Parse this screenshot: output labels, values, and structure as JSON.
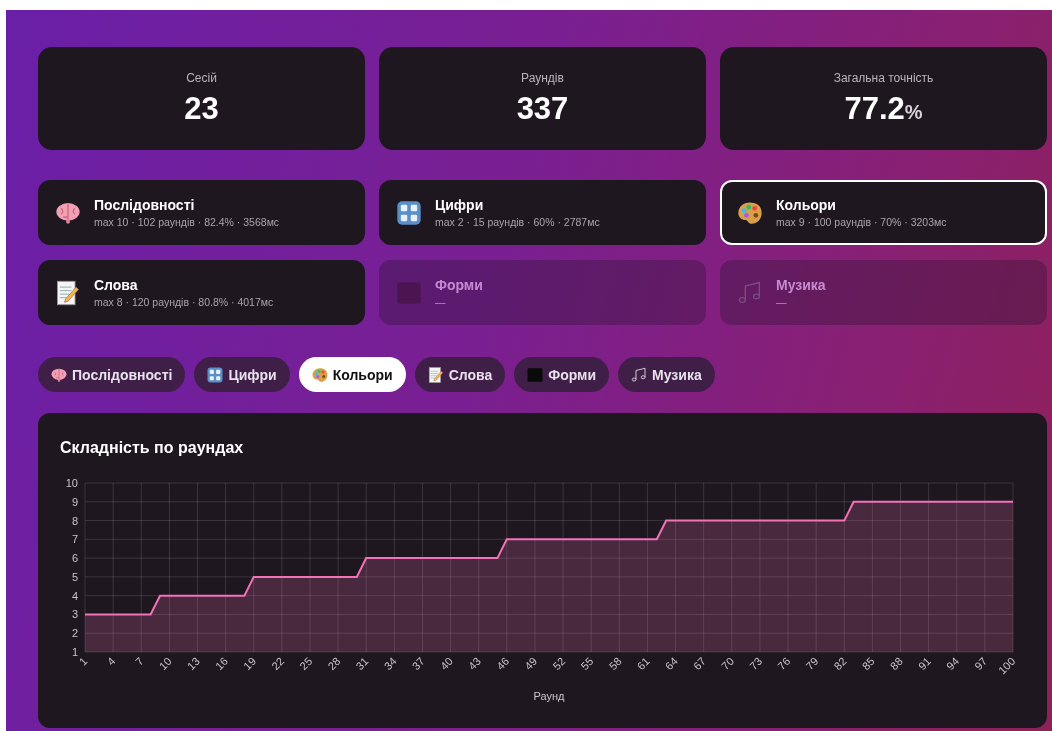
{
  "stats": [
    {
      "label": "Сесій",
      "value": "23"
    },
    {
      "label": "Раундів",
      "value": "337"
    },
    {
      "label": "Загальна точність",
      "value": "77.2",
      "unit": "%"
    }
  ],
  "modes": [
    {
      "name": "Послідовності",
      "details": "max 10 · 102 раундів · 82.4% · 3568мс",
      "selected": false,
      "disabled": false
    },
    {
      "name": "Цифри",
      "details": "max 2 · 15 раундів · 60% · 2787мс",
      "selected": false,
      "disabled": false
    },
    {
      "name": "Кольори",
      "details": "max 9 · 100 раундів · 70% · 3203мс",
      "selected": true,
      "disabled": false
    },
    {
      "name": "Слова",
      "details": "max 8 · 120 раундів · 80.8% · 4017мс",
      "selected": false,
      "disabled": false
    },
    {
      "name": "Форми",
      "details": "—",
      "selected": false,
      "disabled": true
    },
    {
      "name": "Музика",
      "details": "—",
      "selected": false,
      "disabled": true
    }
  ],
  "tabs": [
    {
      "label": "Послідовності",
      "selected": false
    },
    {
      "label": "Цифри",
      "selected": false
    },
    {
      "label": "Кольори",
      "selected": true
    },
    {
      "label": "Слова",
      "selected": false
    },
    {
      "label": "Форми",
      "selected": false
    },
    {
      "label": "Музика",
      "selected": false
    }
  ],
  "chart": {
    "title": "Складність по раундах",
    "chart_data": {
      "type": "area",
      "xlabel": "Раунд",
      "x": [
        1,
        2,
        3,
        4,
        5,
        6,
        7,
        8,
        9,
        10,
        11,
        12,
        13,
        14,
        15,
        16,
        17,
        18,
        19,
        20,
        21,
        22,
        23,
        24,
        25,
        26,
        27,
        28,
        29,
        30,
        31,
        32,
        33,
        34,
        35,
        36,
        37,
        38,
        39,
        40,
        41,
        42,
        43,
        44,
        45,
        46,
        47,
        48,
        49,
        50,
        51,
        52,
        53,
        54,
        55,
        56,
        57,
        58,
        59,
        60,
        61,
        62,
        63,
        64,
        65,
        66,
        67,
        68,
        69,
        70,
        71,
        72,
        73,
        74,
        75,
        76,
        77,
        78,
        79,
        80,
        81,
        82,
        83,
        84,
        85,
        86,
        87,
        88,
        89,
        90,
        91,
        92,
        93,
        94,
        95,
        96,
        97,
        98,
        99,
        100
      ],
      "grid": true,
      "series": [
        {
          "color": "#f472b6",
          "values": [
            3,
            3,
            3,
            3,
            3,
            3,
            3,
            3,
            4,
            4,
            4,
            4,
            4,
            4,
            4,
            4,
            4,
            4,
            5,
            5,
            5,
            5,
            5,
            5,
            5,
            5,
            5,
            5,
            5,
            5,
            6,
            6,
            6,
            6,
            6,
            6,
            6,
            6,
            6,
            6,
            6,
            6,
            6,
            6,
            6,
            7,
            7,
            7,
            7,
            7,
            7,
            7,
            7,
            7,
            7,
            7,
            7,
            7,
            7,
            7,
            7,
            7,
            8,
            8,
            8,
            8,
            8,
            8,
            8,
            8,
            8,
            8,
            8,
            8,
            8,
            8,
            8,
            8,
            8,
            8,
            8,
            8,
            9,
            9,
            9,
            9,
            9,
            9,
            9,
            9,
            9,
            9,
            9,
            9,
            9,
            9,
            9,
            9,
            9,
            9
          ]
        }
      ],
      "xlim": [
        1,
        100
      ],
      "ylim": [
        1,
        10
      ],
      "xticks": [
        1,
        4,
        7,
        10,
        13,
        16,
        19,
        22,
        25,
        28,
        31,
        34,
        37,
        40,
        43,
        46,
        49,
        52,
        55,
        58,
        61,
        64,
        67,
        70,
        73,
        76,
        79,
        82,
        85,
        88,
        91,
        94,
        97,
        100
      ],
      "yticks": [
        1,
        2,
        3,
        4,
        5,
        6,
        7,
        8,
        9,
        10
      ]
    }
  }
}
